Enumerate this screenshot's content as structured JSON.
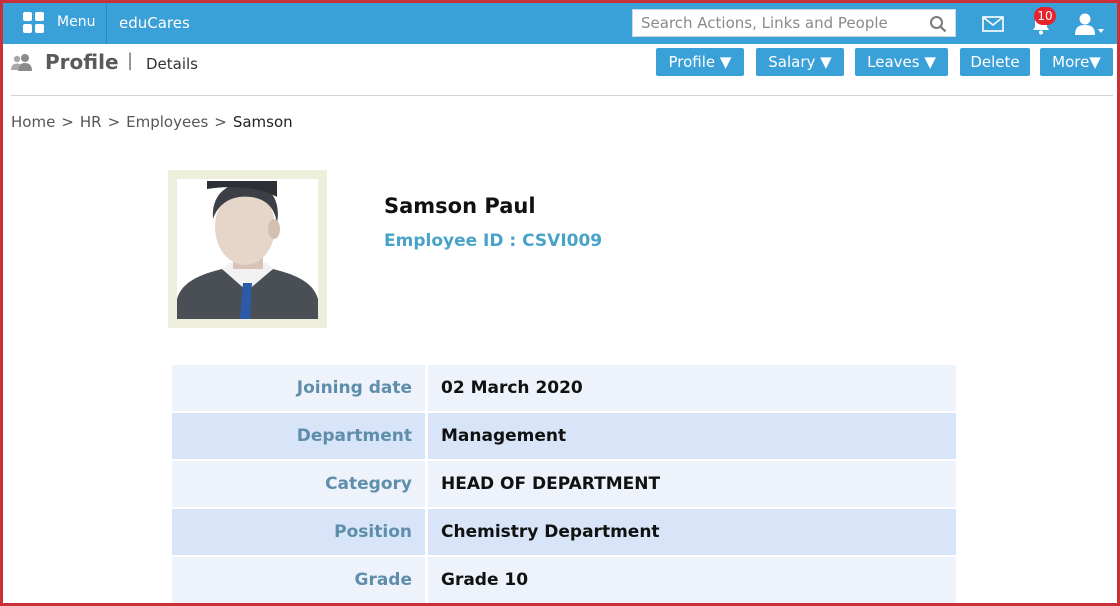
{
  "topbar": {
    "menu_label": "Menu",
    "brand": "eduCares",
    "search_placeholder": "Search Actions, Links and People",
    "notification_count": "10"
  },
  "subheader": {
    "title": "Profile",
    "separator": "|",
    "subtitle": "Details",
    "buttons": [
      "Profile ▼",
      "Salary ▼",
      "Leaves ▼",
      "Delete",
      "More▼"
    ]
  },
  "breadcrumb": {
    "items": [
      "Home",
      "HR",
      "Employees"
    ],
    "current": "Samson",
    "separator": ">"
  },
  "employee": {
    "name": "Samson Paul",
    "id_label": "Employee ID : CSVI009"
  },
  "details": [
    {
      "label": "Joining date",
      "value": "02 March 2020"
    },
    {
      "label": "Department",
      "value": "Management"
    },
    {
      "label": "Category",
      "value": "HEAD OF DEPARTMENT"
    },
    {
      "label": "Position",
      "value": "Chemistry Department"
    },
    {
      "label": "Grade",
      "value": "Grade 10"
    }
  ],
  "colors": {
    "primary": "#3aa0d8",
    "badge": "#e8232c",
    "label": "#5f8eab",
    "row_light": "#edf2fb",
    "row_dark": "#d8e4f8",
    "frame_border": "#c8303a"
  }
}
